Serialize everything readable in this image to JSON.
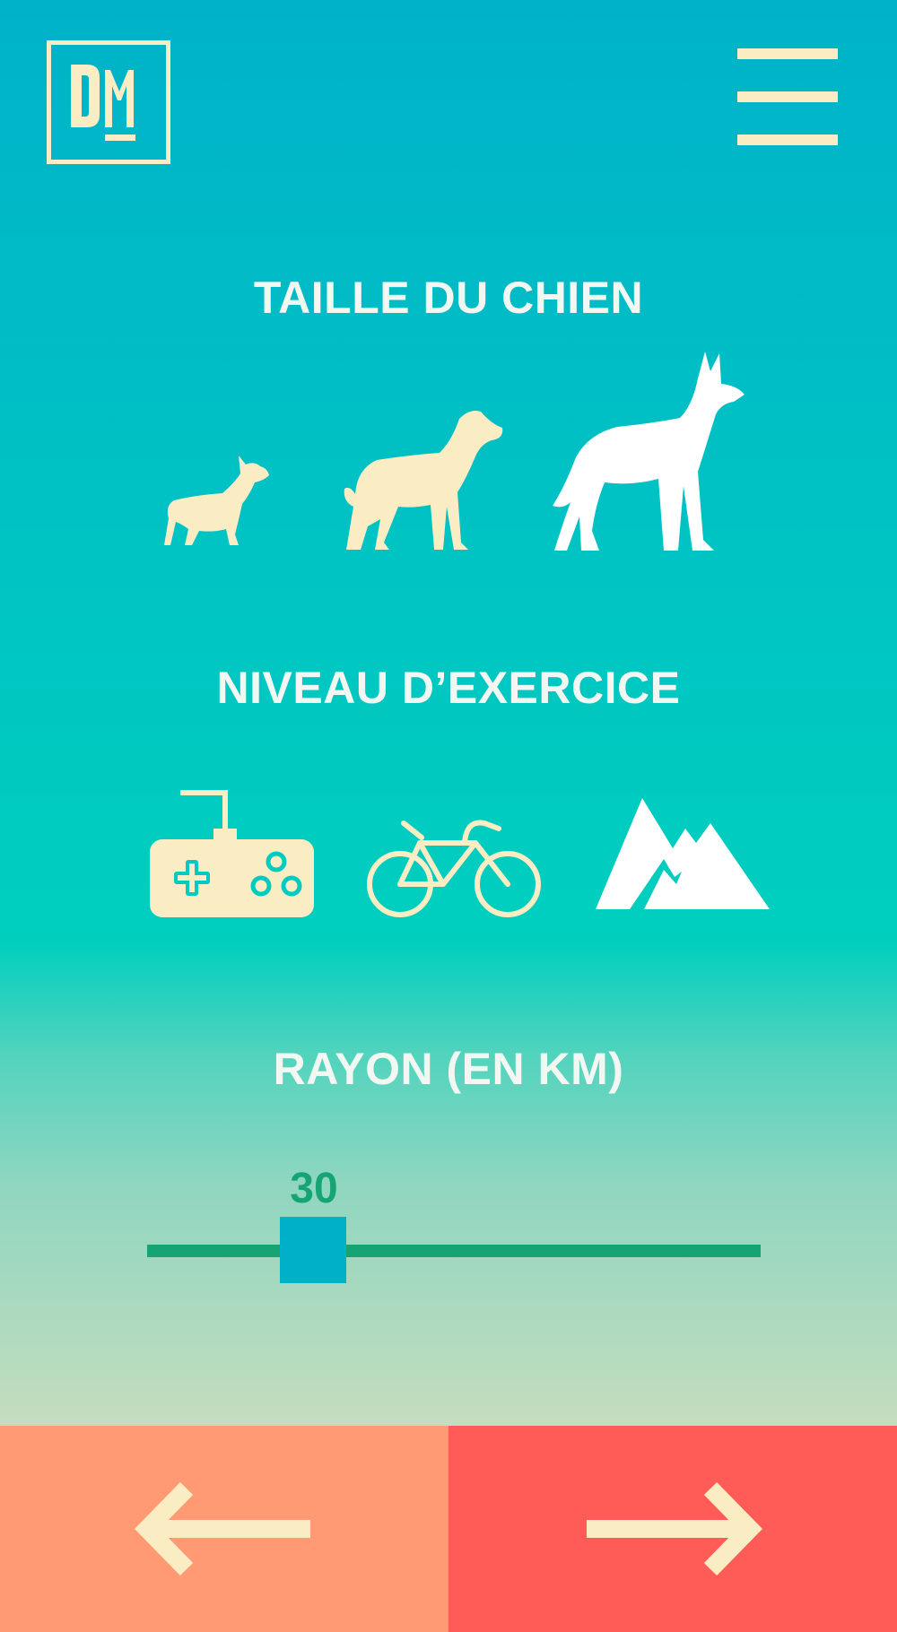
{
  "brand": {
    "logo_text": "DM"
  },
  "header": {
    "menu_icon": "hamburger-menu-icon"
  },
  "sections": {
    "dog_size": {
      "title": "TAILLE DU CHIEN",
      "options": [
        {
          "icon": "small-dog-icon",
          "selected": false
        },
        {
          "icon": "medium-dog-icon",
          "selected": false
        },
        {
          "icon": "large-dog-icon",
          "selected": true
        }
      ]
    },
    "exercise_level": {
      "title": "NIVEAU D’EXERCICE",
      "options": [
        {
          "icon": "gamepad-icon",
          "selected": false
        },
        {
          "icon": "bicycle-icon",
          "selected": false
        },
        {
          "icon": "mountain-icon",
          "selected": true
        }
      ]
    },
    "radius": {
      "title": "RAYON (EN KM)",
      "value": "30"
    }
  },
  "navigation": {
    "prev_icon": "arrow-left-icon",
    "next_icon": "arrow-right-icon"
  },
  "colors": {
    "cream": "#fbedc3",
    "white": "#ffffff",
    "slider_green": "#16a474",
    "thumb_blue": "#00b0c8",
    "prev_button": "#ff9a74",
    "next_button": "#ff5c57"
  }
}
